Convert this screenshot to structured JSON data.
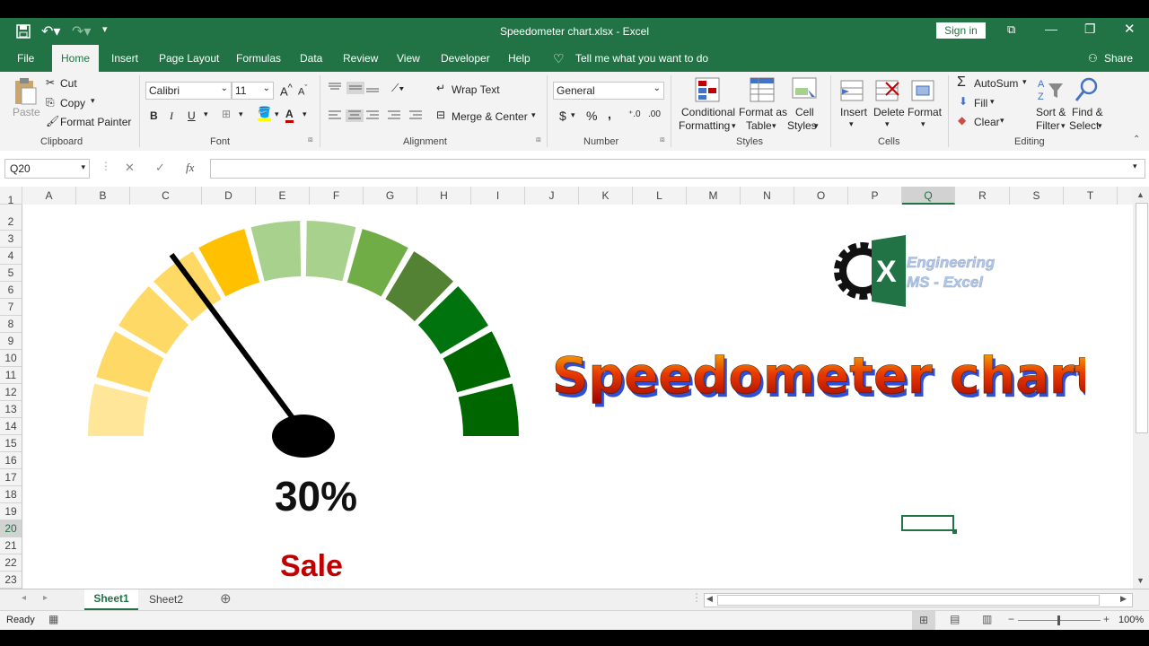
{
  "window": {
    "title": "Speedometer chart.xlsx  -  Excel",
    "sign_in": "Sign in"
  },
  "tabs": [
    "File",
    "Home",
    "Insert",
    "Page Layout",
    "Formulas",
    "Data",
    "Review",
    "View",
    "Developer",
    "Help"
  ],
  "tell_me": "Tell me what you want to do",
  "share": "Share",
  "clipboard": {
    "paste": "Paste",
    "cut": "Cut",
    "copy": "Copy",
    "format_painter": "Format Painter",
    "group": "Clipboard"
  },
  "font": {
    "name": "Calibri",
    "size": "11",
    "group": "Font",
    "bold": "B",
    "italic": "I",
    "underline": "U"
  },
  "alignment": {
    "wrap": "Wrap Text",
    "merge": "Merge & Center",
    "group": "Alignment"
  },
  "number": {
    "format": "General",
    "currency": "$",
    "percent": "%",
    "comma": ",",
    "group": "Number"
  },
  "styles": {
    "conditional_1": "Conditional",
    "conditional_2": "Formatting",
    "format_table_1": "Format as",
    "format_table_2": "Table",
    "cell_styles_1": "Cell",
    "cell_styles_2": "Styles",
    "group": "Styles"
  },
  "cells": {
    "insert": "Insert",
    "delete": "Delete",
    "format": "Format",
    "group": "Cells"
  },
  "editing": {
    "autosum": "AutoSum",
    "fill": "Fill",
    "clear": "Clear",
    "sort_1": "Sort &",
    "sort_2": "Filter",
    "find_1": "Find &",
    "find_2": "Select",
    "group": "Editing"
  },
  "formula_bar": {
    "name_box": "Q20",
    "formula": ""
  },
  "columns": [
    "A",
    "B",
    "C",
    "D",
    "E",
    "F",
    "G",
    "H",
    "I",
    "J",
    "K",
    "L",
    "M",
    "N",
    "O",
    "P",
    "Q",
    "R",
    "S",
    "T"
  ],
  "rows": [
    "1",
    "2",
    "3",
    "4",
    "5",
    "6",
    "7",
    "8",
    "9",
    "10",
    "11",
    "12",
    "13",
    "14",
    "15",
    "16",
    "17",
    "18",
    "19",
    "20",
    "21",
    "22",
    "23"
  ],
  "gauge": {
    "value_label": "30%",
    "value": 0.3,
    "caption": "Sale"
  },
  "logo": {
    "line1": "Engineering",
    "line2": "MS - Excel",
    "letter": "X"
  },
  "headline": "Speedometer chart",
  "sheets": [
    "Sheet1",
    "Sheet2"
  ],
  "status": {
    "ready": "Ready",
    "zoom": "100%"
  },
  "colors": {
    "excel_green": "#217346",
    "gauge_colors": [
      "#ffe699",
      "#ffd966",
      "#ffd966",
      "#ffd966",
      "#ffc000",
      "#a9d18e",
      "#a9d18e",
      "#70ad47",
      "#548235",
      "#00730f",
      "#006600",
      "#006600"
    ]
  }
}
